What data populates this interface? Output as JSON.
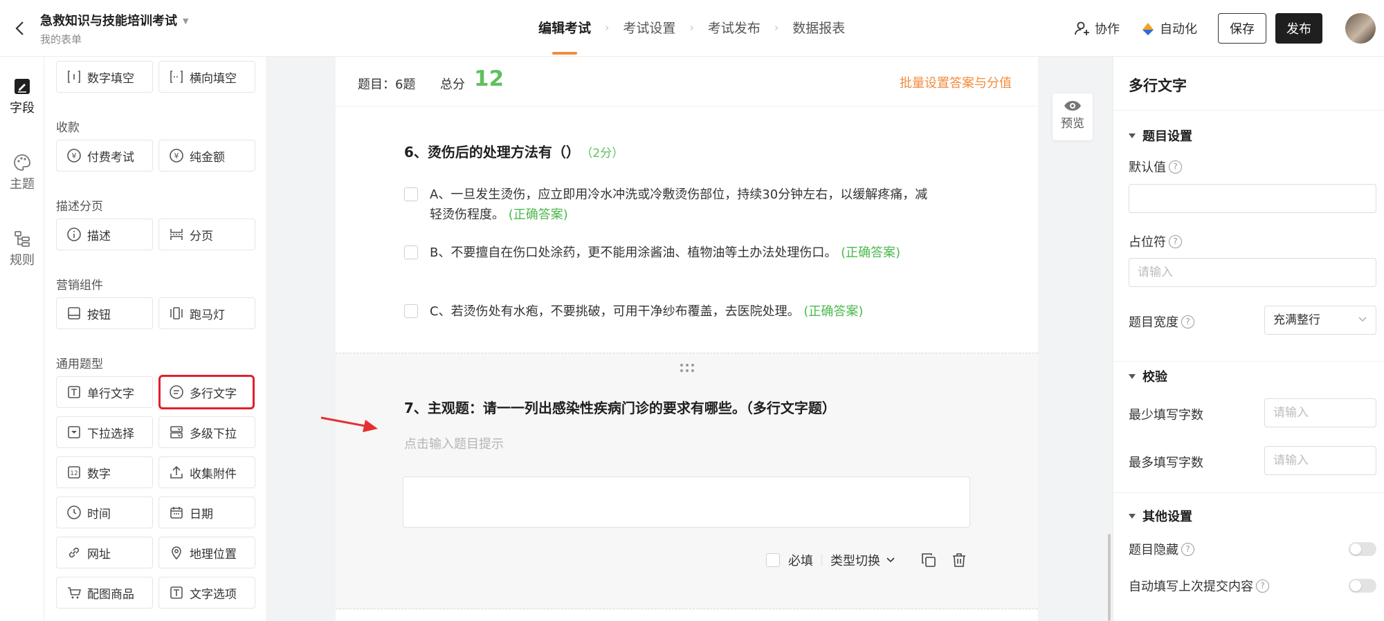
{
  "header": {
    "title": "急救知识与技能培训考试",
    "subtitle": "我的表单",
    "steps": [
      {
        "label": "编辑考试"
      },
      {
        "label": "考试设置"
      },
      {
        "label": "考试发布"
      },
      {
        "label": "数据报表"
      }
    ],
    "collab_label": "协作",
    "auto_label": "自动化",
    "save_label": "保存",
    "publish_label": "发布"
  },
  "rail": {
    "items": [
      {
        "label": "字段",
        "icon": "field-icon"
      },
      {
        "label": "主题",
        "icon": "palette-icon"
      },
      {
        "label": "规则",
        "icon": "rule-icon"
      }
    ]
  },
  "panel": {
    "groups": {
      "payment": "收款",
      "desc": "描述分页",
      "marketing": "营销组件",
      "general": "通用题型"
    },
    "items": {
      "num_fill": "数字填空",
      "h_fill": "横向填空",
      "paid_exam": "付费考试",
      "pure_amount": "纯金额",
      "desc": "描述",
      "paging": "分页",
      "button": "按钮",
      "marquee": "跑马灯",
      "single_text": "单行文字",
      "multi_text": "多行文字",
      "dropdown": "下拉选择",
      "cascade": "多级下拉",
      "number": "数字",
      "attachment": "收集附件",
      "time": "时间",
      "date": "日期",
      "url": "网址",
      "location": "地理位置",
      "product": "配图商品",
      "text_option": "文字选项"
    }
  },
  "sheet": {
    "q_count": "题目：6题",
    "total_label": "总分",
    "total_value": "12",
    "batch_link": "批量设置答案与分值",
    "q6": {
      "title": "6、烫伤后的处理方法有（）",
      "points": "（2分）",
      "options": [
        {
          "text": "A、一旦发生烫伤，应立即用冷水冲洗或冷敷烫伤部位，持续30分钟左右，以缓解疼痛，减轻烫伤程度。",
          "tag": "(正确答案)"
        },
        {
          "text": "B、不要擅自在伤口处涂药，更不能用涂酱油、植物油等土办法处理伤口。",
          "tag": "(正确答案)"
        },
        {
          "text": "C、若烫伤处有水疱，不要挑破，可用干净纱布覆盖，去医院处理。",
          "tag": "(正确答案)"
        }
      ]
    },
    "q7": {
      "title": "7、主观题：请一一列出感染性疾病门诊的要求有哪些。（多行文字题）",
      "hint": "点击输入题目提示",
      "required_label": "必填",
      "switch_label": "类型切换"
    }
  },
  "preview_label": "预览",
  "props": {
    "title": "多行文字",
    "sections": {
      "question": "题目设置",
      "validation": "校验",
      "other": "其他设置"
    },
    "default_label": "默认值",
    "placeholder_label": "占位符",
    "placeholder_hint": "请输入",
    "width_label": "题目宽度",
    "width_value": "充满整行",
    "min_label": "最少填写字数",
    "max_label": "最多填写字数",
    "input_hint": "请输入",
    "hide_label": "题目隐藏",
    "autofill_label": "自动填写上次提交内容"
  },
  "colors": {
    "accent": "#f28b3c",
    "correct": "#4cb84c",
    "highlight": "#e0202a"
  }
}
